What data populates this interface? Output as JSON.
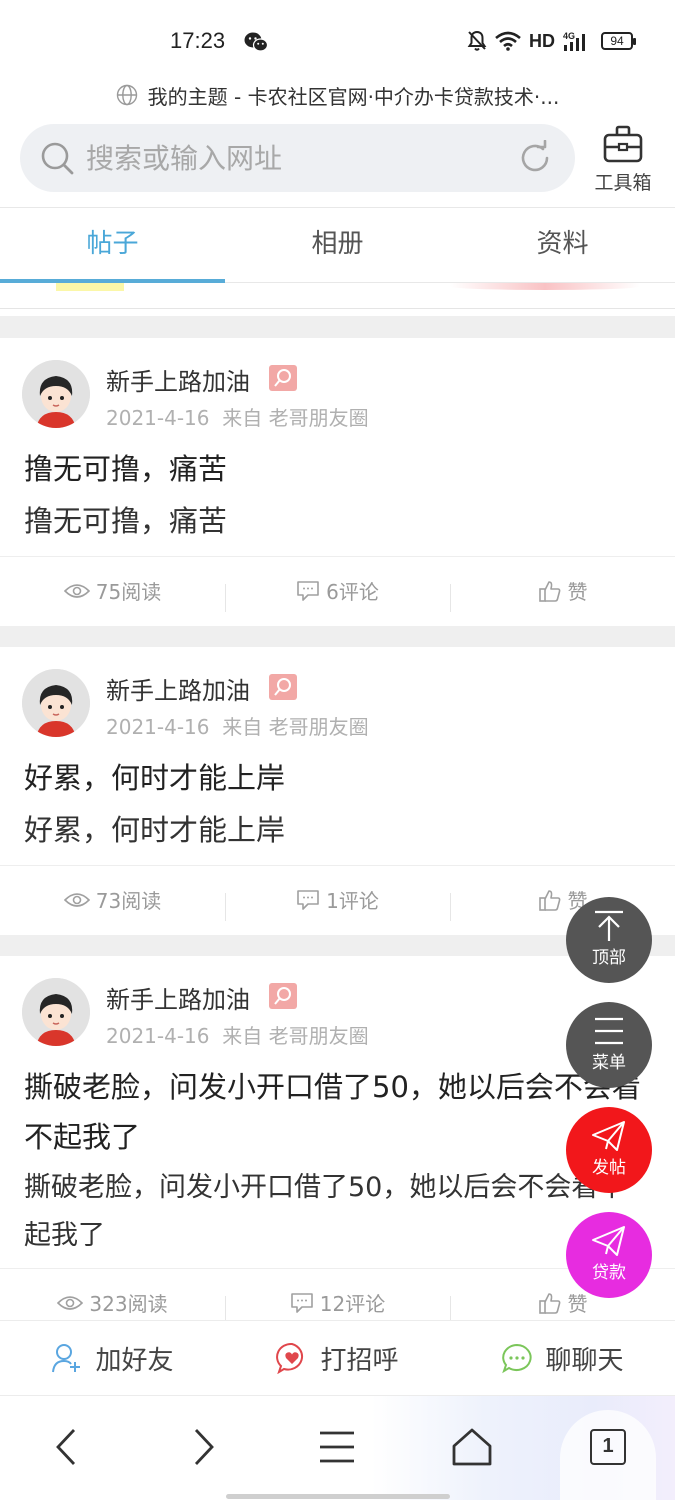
{
  "status_bar": {
    "time": "17:23",
    "network": "HD",
    "signal": "4G",
    "battery": "94"
  },
  "browser": {
    "page_title": "我的主题 - 卡农社区官网·中介办卡贷款技术·...",
    "search_placeholder": "搜索或输入网址",
    "toolbox_label": "工具箱"
  },
  "tabs": [
    {
      "label": "帖子",
      "active": true
    },
    {
      "label": "相册",
      "active": false
    },
    {
      "label": "资料",
      "active": false
    }
  ],
  "posts": [
    {
      "author": "新手上路加油",
      "date": "2021-4-16",
      "source": "来自 老哥朋友圈",
      "title": "撸无可撸，痛苦",
      "body": "撸无可撸，痛苦",
      "reads": "75阅读",
      "comments": "6评论",
      "like": "赞"
    },
    {
      "author": "新手上路加油",
      "date": "2021-4-16",
      "source": "来自 老哥朋友圈",
      "title": "好累，何时才能上岸",
      "body": "好累，何时才能上岸",
      "reads": "73阅读",
      "comments": "1评论",
      "like": "赞"
    },
    {
      "author": "新手上路加油",
      "date": "2021-4-16",
      "source": "来自 老哥朋友圈",
      "title": "撕破老脸，问发小开口借了50，她以后会不会看不起我了",
      "body": "撕破老脸，问发小开口借了50，她以后会不会看不起我了",
      "reads": "323阅读",
      "comments": "12评论",
      "like": "赞"
    }
  ],
  "floating_buttons": {
    "top": "顶部",
    "menu": "菜单",
    "post": "发帖",
    "loan": "贷款"
  },
  "friend_bar": {
    "add_friend": "加好友",
    "greet": "打招呼",
    "chat": "聊聊天"
  },
  "nav": {
    "tab_count": "1"
  },
  "colors": {
    "accent_blue": "#4aa7d8",
    "post_button_red": "#f2171b",
    "loan_button_magenta": "#e72ce0",
    "fab_gray": "#555555"
  }
}
